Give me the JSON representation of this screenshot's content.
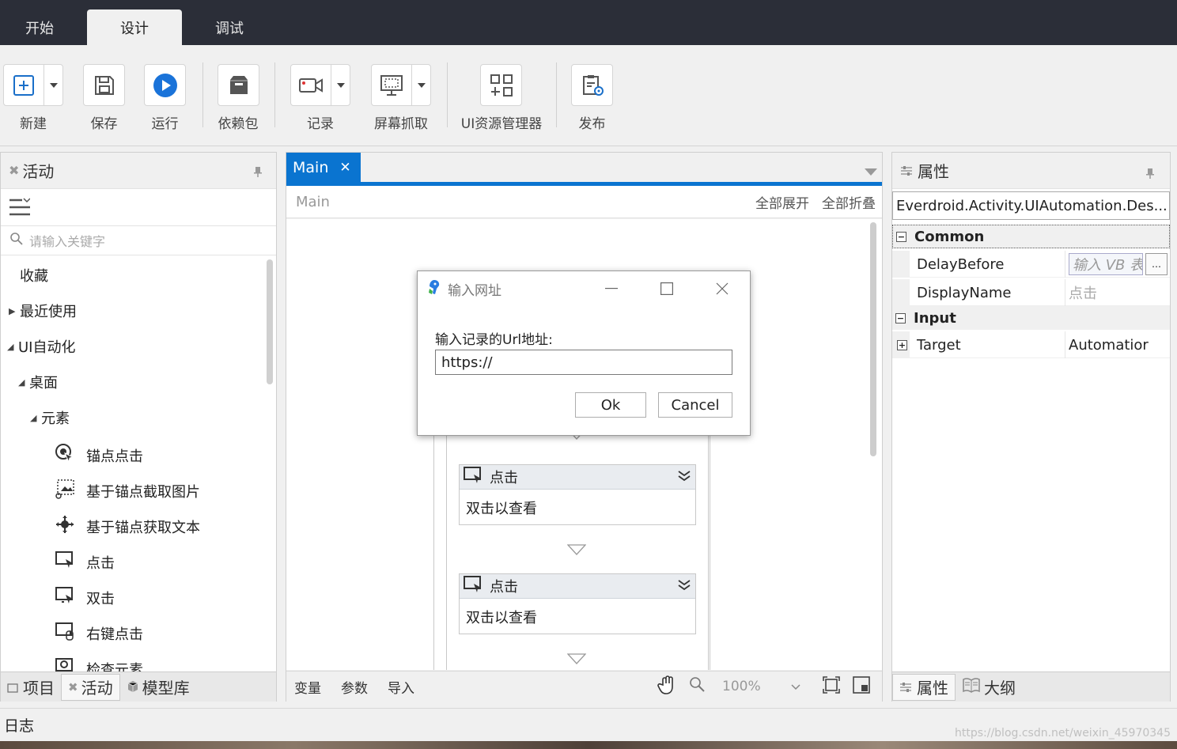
{
  "top_tabs": [
    "开始",
    "设计",
    "调试"
  ],
  "ribbon": {
    "new": "新建",
    "save": "保存",
    "run": "运行",
    "dependencies": "依赖包",
    "record": "记录",
    "screen_capture": "屏幕抓取",
    "ui_resource_manager": "UI资源管理器",
    "publish": "发布"
  },
  "activities_panel": {
    "title": "活动",
    "search_placeholder": "请输入关键字",
    "tree": {
      "favorites": "收藏",
      "recent": "最近使用",
      "ui_automation": "UI自动化",
      "desktop": "桌面",
      "elements": "元素",
      "items": [
        "锚点点击",
        "基于锚点截取图片",
        "基于锚点获取文本",
        "点击",
        "双击",
        "右键点击",
        "检查元素"
      ]
    },
    "bottom_tabs": [
      "项目",
      "活动",
      "模型库"
    ]
  },
  "designer": {
    "tab_label": "Main",
    "breadcrumb": "Main",
    "expand_all": "全部展开",
    "collapse_all": "全部折叠",
    "activities": [
      {
        "title": "点击",
        "body": "双击以查看"
      },
      {
        "title": "点击",
        "body": "双击以查看"
      }
    ],
    "footer": {
      "variables": "变量",
      "arguments": "参数",
      "imports": "导入",
      "zoom": "100%"
    }
  },
  "dialog": {
    "title": "输入网址",
    "prompt": "输入记录的Url地址:",
    "url_value": "https://",
    "ok": "Ok",
    "cancel": "Cancel"
  },
  "properties_panel": {
    "title": "属性",
    "type_name": "Everdroid.Activity.UIAutomation.Des...",
    "categories": {
      "common": "Common",
      "input": "Input"
    },
    "rows": {
      "delay_before": {
        "name": "DelayBefore",
        "placeholder": "输入 VB 表"
      },
      "display_name": {
        "name": "DisplayName",
        "value": "点击"
      },
      "target": {
        "name": "Target",
        "value": "Automatior"
      }
    },
    "bottom_tabs": [
      "属性",
      "大纲"
    ]
  },
  "log_label": "日志",
  "watermark": "https://blog.csdn.net/weixin_45970345",
  "colors": {
    "accent": "#0a74d0",
    "titlebar": "#2b2e38"
  }
}
